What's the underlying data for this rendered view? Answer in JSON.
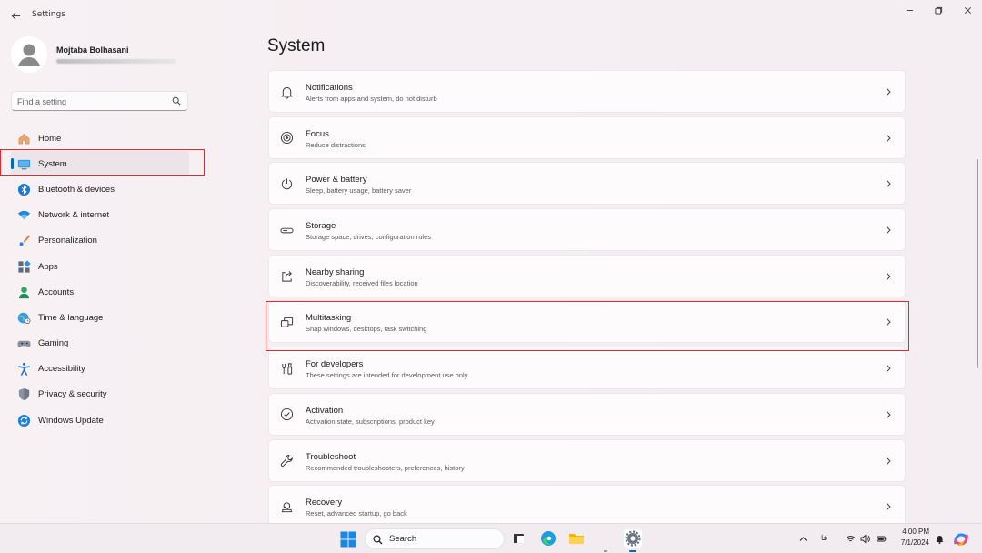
{
  "app": {
    "title": "Settings"
  },
  "user": {
    "name": "Mojtaba Bolhasani"
  },
  "search": {
    "placeholder": "Find a setting"
  },
  "nav": [
    {
      "label": "Home",
      "icon": "home-icon"
    },
    {
      "label": "System",
      "icon": "system-icon",
      "active": true
    },
    {
      "label": "Bluetooth & devices",
      "icon": "bluetooth-icon"
    },
    {
      "label": "Network & internet",
      "icon": "wifi-icon"
    },
    {
      "label": "Personalization",
      "icon": "brush-icon"
    },
    {
      "label": "Apps",
      "icon": "apps-icon"
    },
    {
      "label": "Accounts",
      "icon": "accounts-icon"
    },
    {
      "label": "Time & language",
      "icon": "globe-icon"
    },
    {
      "label": "Gaming",
      "icon": "gamepad-icon"
    },
    {
      "label": "Accessibility",
      "icon": "accessibility-icon"
    },
    {
      "label": "Privacy & security",
      "icon": "shield-icon"
    },
    {
      "label": "Windows Update",
      "icon": "update-icon"
    }
  ],
  "main": {
    "title": "System",
    "cards": [
      {
        "title": "Notifications",
        "subtitle": "Alerts from apps and system, do not disturb",
        "icon": "bell-icon"
      },
      {
        "title": "Focus",
        "subtitle": "Reduce distractions",
        "icon": "focus-icon"
      },
      {
        "title": "Power & battery",
        "subtitle": "Sleep, battery usage, battery saver",
        "icon": "power-icon"
      },
      {
        "title": "Storage",
        "subtitle": "Storage space, drives, configuration rules",
        "icon": "storage-icon"
      },
      {
        "title": "Nearby sharing",
        "subtitle": "Discoverability, received files location",
        "icon": "share-icon"
      },
      {
        "title": "Multitasking",
        "subtitle": "Snap windows, desktops, task switching",
        "icon": "multitasking-icon"
      },
      {
        "title": "For developers",
        "subtitle": "These settings are intended for development use only",
        "icon": "developer-tools-icon"
      },
      {
        "title": "Activation",
        "subtitle": "Activation state, subscriptions, product key",
        "icon": "check-circle-icon"
      },
      {
        "title": "Troubleshoot",
        "subtitle": "Recommended troubleshooters, preferences, history",
        "icon": "wrench-icon"
      },
      {
        "title": "Recovery",
        "subtitle": "Reset, advanced startup, go back",
        "icon": "recovery-icon"
      }
    ]
  },
  "taskbar": {
    "search_label": "Search",
    "time": "4:00 PM",
    "date": "7/1/2024",
    "language": "فا"
  },
  "colors": {
    "accent": "#0067c0",
    "highlight": "#e0282e"
  }
}
